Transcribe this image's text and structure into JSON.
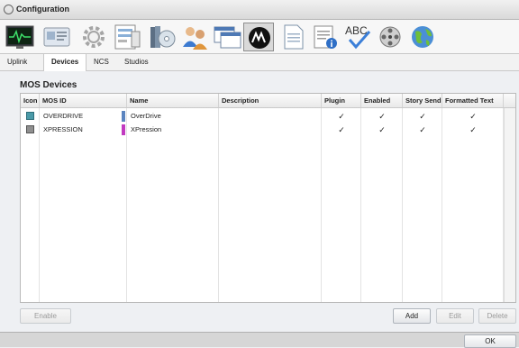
{
  "window": {
    "title": "Configuration"
  },
  "toolbar": {
    "items": [
      {
        "name": "monitor-icon"
      },
      {
        "name": "device-card-icon"
      },
      {
        "name": "gear-icon"
      },
      {
        "name": "forms-icon"
      },
      {
        "name": "media-disc-icon"
      },
      {
        "name": "users-icon"
      },
      {
        "name": "windows-icon"
      },
      {
        "name": "mos-logo-icon"
      },
      {
        "name": "document-icon"
      },
      {
        "name": "document-info-icon"
      },
      {
        "name": "spellcheck-icon"
      },
      {
        "name": "film-reel-icon"
      },
      {
        "name": "globe-icon"
      }
    ],
    "active_index": 7
  },
  "tabs": [
    {
      "label": "Uplink"
    },
    {
      "label": "Devices"
    },
    {
      "label": "NCS"
    },
    {
      "label": "Studios"
    }
  ],
  "selected_tab": "Devices",
  "section": {
    "title": "MOS Devices"
  },
  "table": {
    "columns": [
      "Icon",
      "MOS ID",
      "Name",
      "Description",
      "Plugin",
      "Enabled",
      "Story Send",
      "Formatted Text"
    ],
    "rows": [
      {
        "icon": "overdrive-device-icon",
        "mos_id": "OVERDRIVE",
        "name": "OverDrive",
        "description": "",
        "color": "#5b84bf",
        "plugin": "✓",
        "enabled": "✓",
        "story_send": "✓",
        "formatted_text": "✓"
      },
      {
        "icon": "xpression-device-icon",
        "mos_id": "XPRESSION",
        "name": "XPression",
        "description": "",
        "color": "#c13ac0",
        "plugin": "✓",
        "enabled": "✓",
        "story_send": "✓",
        "formatted_text": "✓"
      }
    ]
  },
  "buttons": {
    "enable": "Enable",
    "add": "Add",
    "edit": "Edit",
    "delete": "Delete",
    "ok": "OK"
  }
}
